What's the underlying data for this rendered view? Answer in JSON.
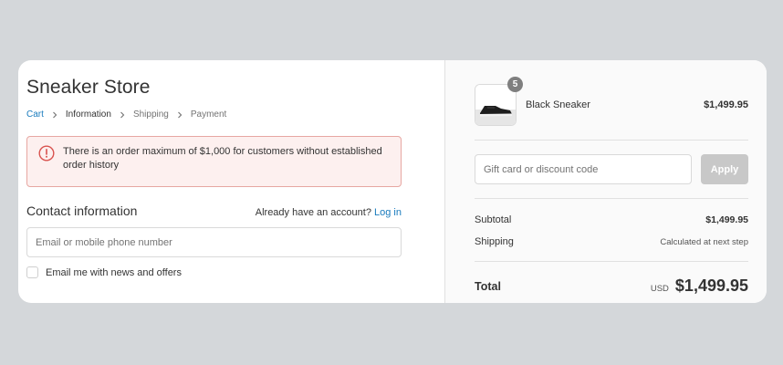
{
  "store": {
    "title": "Sneaker Store"
  },
  "breadcrumb": {
    "items": [
      "Cart",
      "Information",
      "Shipping",
      "Payment"
    ]
  },
  "alert": {
    "message": "There is an order maximum of $1,000 for customers without established order history"
  },
  "contact": {
    "heading": "Contact information",
    "account_prompt": "Already have an account?",
    "login_label": "Log in",
    "email_placeholder": "Email or mobile phone number",
    "newsletter_label": "Email me with news and offers"
  },
  "order": {
    "product": {
      "name": "Black Sneaker",
      "price": "$1,499.95",
      "quantity": "5"
    },
    "discount_placeholder": "Gift card or discount code",
    "apply_label": "Apply",
    "subtotal_label": "Subtotal",
    "subtotal_value": "$1,499.95",
    "shipping_label": "Shipping",
    "shipping_value": "Calculated at next step",
    "total_label": "Total",
    "currency": "USD",
    "total_value": "$1,499.95"
  },
  "colors": {
    "accent": "#197bbd",
    "alert_bg": "#fdf0ef",
    "alert_border": "#e7a7a2",
    "alert_icon": "#d9534f",
    "apply_disabled": "#c8c8c8"
  }
}
